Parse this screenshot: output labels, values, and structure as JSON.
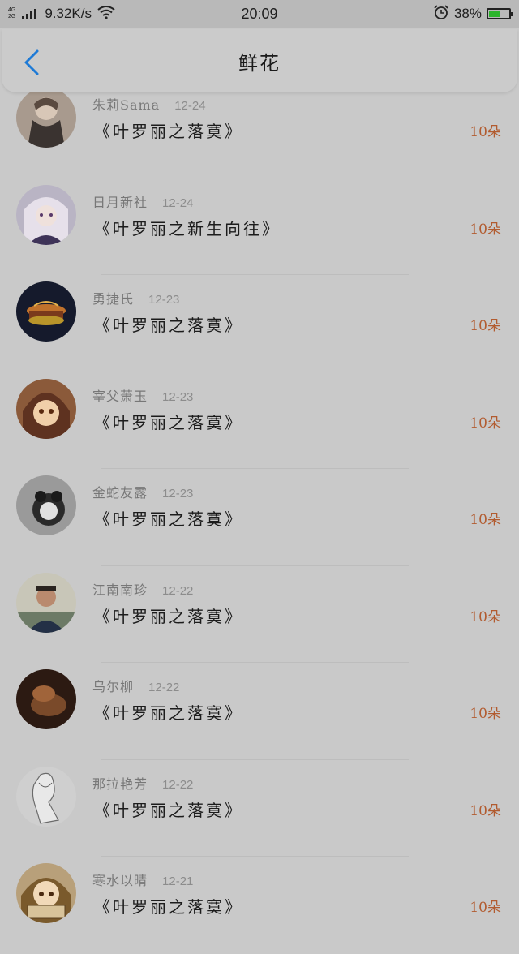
{
  "status": {
    "network_top": "4G",
    "network_bottom": "2G",
    "speed": "9.32K/s",
    "time": "20:09",
    "battery": "38%",
    "battery_level": 0.38
  },
  "header": {
    "title": "鲜花",
    "back_icon": "chevron-left-icon",
    "accent": "#1e7ad6"
  },
  "colors": {
    "count": "#b25b2f"
  },
  "items": [
    {
      "name": "朱莉Sama",
      "date": "12-24",
      "book": "《叶罗丽之落寞》",
      "count": "10朵"
    },
    {
      "name": "日月新社",
      "date": "12-24",
      "book": "《叶罗丽之新生向往》",
      "count": "10朵"
    },
    {
      "name": "勇捷氏",
      "date": "12-23",
      "book": "《叶罗丽之落寞》",
      "count": "10朵"
    },
    {
      "name": "宰父萧玉",
      "date": "12-23",
      "book": "《叶罗丽之落寞》",
      "count": "10朵"
    },
    {
      "name": "金蛇友露",
      "date": "12-23",
      "book": "《叶罗丽之落寞》",
      "count": "10朵"
    },
    {
      "name": "江南南珍",
      "date": "12-22",
      "book": "《叶罗丽之落寞》",
      "count": "10朵"
    },
    {
      "name": "乌尔柳",
      "date": "12-22",
      "book": "《叶罗丽之落寞》",
      "count": "10朵"
    },
    {
      "name": "那拉艳芳",
      "date": "12-22",
      "book": "《叶罗丽之落寞》",
      "count": "10朵"
    },
    {
      "name": "寒水以晴",
      "date": "12-21",
      "book": "《叶罗丽之落寞》",
      "count": "10朵"
    }
  ]
}
